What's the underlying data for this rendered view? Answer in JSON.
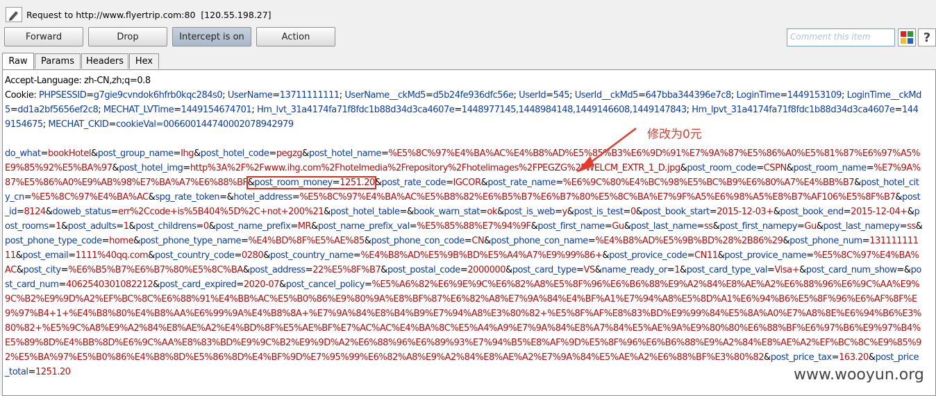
{
  "window": {
    "title": "Request to http://www.flyertrip.com:80  [120.55.198.27]"
  },
  "toolbar": {
    "forward_label": "Forward",
    "drop_label": "Drop",
    "intercept_label": "Intercept is on",
    "action_label": "Action",
    "comment_placeholder": "Comment this item",
    "help_label": "?"
  },
  "tabs": [
    "Raw",
    "Params",
    "Headers",
    "Hex"
  ],
  "colors": {
    "param_name": "#0b3ea8",
    "param_value": "#b30e0e",
    "annotation": "#e53b2e"
  },
  "request": {
    "accept_language": "Accept-Language: zh-CN,zh;q=0.8",
    "cookie_prefix": "Cookie: ",
    "cookies": [
      {
        "name": "PHPSESSID",
        "value": "g7gie9cvndok6hfrb0kqc284s0"
      },
      {
        "name": "UserName",
        "value": "13711111111"
      },
      {
        "name": "UserName__ckMd5",
        "value": "d5b24fe936dfc56e"
      },
      {
        "name": "UserId",
        "value": "545"
      },
      {
        "name": "UserId__ckMd5",
        "value": "647bba344396e7c8"
      },
      {
        "name": "LoginTime",
        "value": "1449153109"
      },
      {
        "name": "LoginTime__ckMd5",
        "value": "dd1a2bf5656ef2c8"
      },
      {
        "name": "MECHAT_LVTime",
        "value": "1449154674701"
      },
      {
        "name": "Hm_lvt_31a4174fa71f8fdc1b88d34d3ca4607e",
        "value": "1448977145,1448984148,1449146608,1449147843"
      },
      {
        "name": "Hm_lpvt_31a4174fa71f8fdc1b88d34d3ca4607e",
        "value": "1449154675"
      },
      {
        "name": "MECHAT_CKID",
        "value": "cookieVal=006600144740002078942979"
      }
    ],
    "body_params": [
      {
        "name": "do_what",
        "value": "bookHotel"
      },
      {
        "name": "post_group_name",
        "value": "Ihg"
      },
      {
        "name": "post_hotel_code",
        "value": "pegzg"
      },
      {
        "name": "post_hotel_name",
        "value": "%E5%8C%97%E4%BA%AC%E4%B8%AD%E5%85%B3%E6%9D%91%E7%9A%87%E5%86%A0%E5%81%87%E6%97%A5%E9%85%92%E5%BA%97"
      },
      {
        "name": "post_hotel_img",
        "value": "http%3A%2F%2Fwww.ihg.com%2Fhotelmedia%2Frepository%2Fhotelimages%2FPEGZG%2FWELCM_EXTR_1_D.jpg"
      },
      {
        "name": "post_room_code",
        "value": "CSPN"
      },
      {
        "name": "post_room_name",
        "value": "%E7%9A%87%E5%86%A0%E9%AB%98%E7%BA%A7%E6%88%BF"
      },
      {
        "name": "post_room_money",
        "value": "1251.20",
        "highlight": true
      },
      {
        "name": "post_rate_code",
        "value": "IGCOR"
      },
      {
        "name": "post_rate_name",
        "value": "%E6%9C%80%E4%BC%98%E5%BC%B9%E6%80%A7%E4%BB%B7"
      },
      {
        "name": "post_hotel_city_cn",
        "value": "%E5%8C%97%E4%BA%AC"
      },
      {
        "name": "spg_rate_token",
        "value": ""
      },
      {
        "name": "hotel_address",
        "value": "%E5%8C%97%E4%BA%AC%E5%B8%82%E6%B5%B7%E6%B7%80%E5%8C%BA%E7%9F%A5%E6%98%A5%E8%B7%AF106%E5%8F%B7"
      },
      {
        "name": "post_id",
        "value": "8124"
      },
      {
        "name": "doweb_status",
        "value": "err%2Ccode+is%5B404%5D%2C+not+200%21"
      },
      {
        "name": "post_hotel_table",
        "value": ""
      },
      {
        "name": "book_warn_stat",
        "value": "ok"
      },
      {
        "name": "post_is_web",
        "value": "y"
      },
      {
        "name": "post_is_test",
        "value": "0"
      },
      {
        "name": "post_book_start",
        "value": "2015-12-03+"
      },
      {
        "name": "post_book_end",
        "value": "2015-12-04+"
      },
      {
        "name": "post_rooms",
        "value": "1"
      },
      {
        "name": "post_adults",
        "value": "1"
      },
      {
        "name": "post_childrens",
        "value": "0"
      },
      {
        "name": "post_name_prefix",
        "value": "MR"
      },
      {
        "name": "post_name_prefix_val",
        "value": "%E5%85%88%E7%94%9F"
      },
      {
        "name": "post_first_name",
        "value": "Gu"
      },
      {
        "name": "post_last_name",
        "value": "ss"
      },
      {
        "name": "post_first_namepy",
        "value": "Gu"
      },
      {
        "name": "post_last_namepy",
        "value": "ss"
      },
      {
        "name": "post_phone_type_code",
        "value": "home"
      },
      {
        "name": "post_phone_type_name",
        "value": "%E4%BD%8F%E5%AE%85"
      },
      {
        "name": "post_phone_con_code",
        "value": "CN"
      },
      {
        "name": "post_phone_con_name",
        "value": "%E4%B8%AD%E5%9B%BD%28%2B86%29"
      },
      {
        "name": "post_phone_num",
        "value": "13111111111"
      },
      {
        "name": "post_email",
        "value": "1111%40qq.com"
      },
      {
        "name": "post_country_code",
        "value": "0280"
      },
      {
        "name": "post_country_name",
        "value": "%E4%B8%AD%E5%9B%BD%E5%A4%A7%E9%99%86+"
      },
      {
        "name": "post_provice_code",
        "value": "CN11"
      },
      {
        "name": "post_provice_name",
        "value": "%E5%8C%97%E4%BA%AC"
      },
      {
        "name": "post_city",
        "value": "%E6%B5%B7%E6%B7%80%E5%8C%BA"
      },
      {
        "name": "post_address",
        "value": "22%E5%8F%B7"
      },
      {
        "name": "post_postal_code",
        "value": "2000000"
      },
      {
        "name": "post_card_type",
        "value": "VS"
      },
      {
        "name": "name_ready_or",
        "value": "1"
      },
      {
        "name": "post_card_type_val",
        "value": "Visa+"
      },
      {
        "name": "post_card_num_show",
        "value": ""
      },
      {
        "name": "post_card_num",
        "value": "4062540301082212"
      },
      {
        "name": "post_card_expired",
        "value": "2020-07"
      },
      {
        "name": "post_cancel_policy",
        "value": "%E5%A6%82%E6%9E%9C%E6%82%A8%E5%8F%96%E6%B6%88%E9%A2%84%E8%AE%A2%E6%88%96%E6%9C%AA%E9%9C%B2%E9%9D%A2%EF%BC%8C%E6%88%91%E4%BB%AC%E5%B0%86%E9%80%9A%E8%BF%87%E6%82%A8%E7%9A%84%E4%BF%A1%E7%94%A8%E5%8D%A1%E6%94%B6%E5%8F%96%E6%AF%8F%E9%97%B4+1+%E4%B8%80%E4%B8%AA%E6%99%9A%E4%B8%8A+%E7%9A%84%E8%B4%B9%E7%94%A8%E3%80%82+%E5%8F%AF%E8%83%BD%E9%99%84%E5%8A%A0%E7%A8%8E%E6%94%B6%E3%80%82+%E5%9C%A8%E9%A2%84%E8%AE%A2%E4%BD%8F%E5%AE%BF%E7%AC%AC%E4%BA%8C%E5%A4%A9%E7%9A%84%E8%A7%84%E5%AE%9A%E9%80%80%E6%88%BF%E6%97%B6%E9%97%B4%E5%89%8D%E4%BB%8D%E6%9C%AA%E8%83%BD%E9%9C%B2%E9%9D%A2%E6%88%96%E6%89%93%E7%94%B5%E8%AF%9D%E5%8F%96%E6%B6%88%E9%A2%84%E8%AE%A2%EF%BC%8C%E9%85%92%E5%BA%97%E5%B0%86%E4%B8%8D%E5%86%8D%E4%BF%9D%E7%95%99%E6%82%A8%E9%A2%84%E8%AE%A2%E7%9A%84%E5%AE%A2%E6%88%BF%E3%80%82"
      },
      {
        "name": "post_price_tax",
        "value": "163.20"
      },
      {
        "name": "post_price_total",
        "value": "1251.20"
      }
    ]
  },
  "annotation": {
    "text": "修改为0元"
  },
  "watermark": "www.wooyun.org"
}
